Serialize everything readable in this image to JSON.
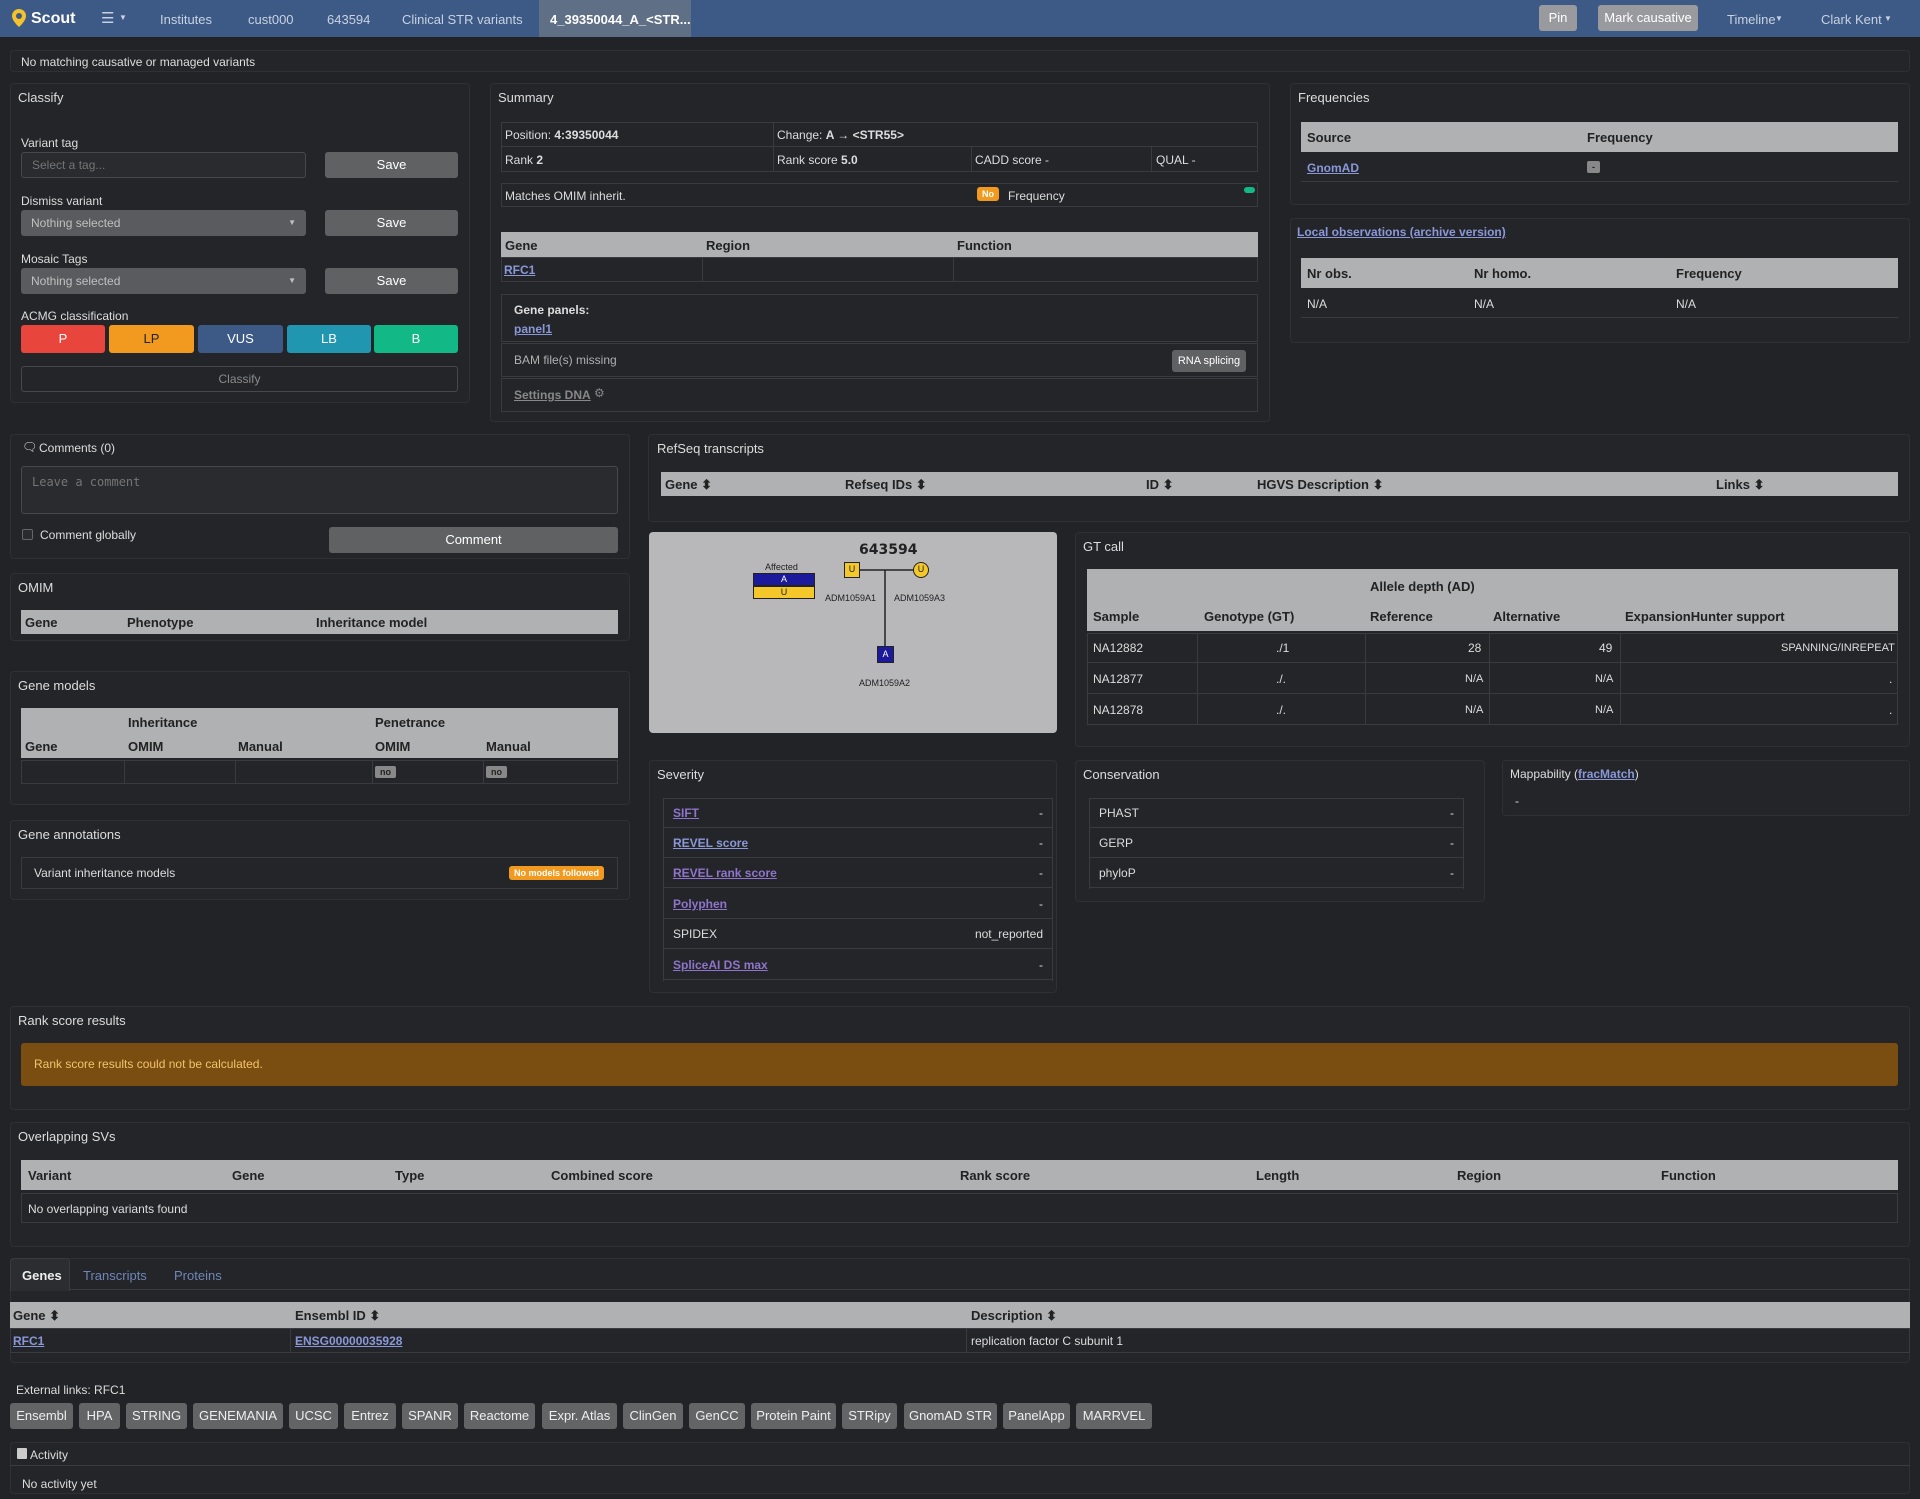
{
  "nav": {
    "brand": "Scout",
    "menu_icon": "☰",
    "items": [
      "Institutes",
      "cust000",
      "643594",
      "Clinical STR variants",
      "4_39350044_A_<STR..."
    ],
    "pin": "Pin",
    "mark_causative": "Mark causative",
    "timeline": "Timeline",
    "user": "Clark Kent"
  },
  "banner": "No matching causative or managed variants",
  "classify": {
    "title": "Classify",
    "tag_label": "Variant tag",
    "tag_placeholder": "Select a tag...",
    "save": "Save",
    "dismiss_label": "Dismiss variant",
    "dismiss_value": "Nothing selected",
    "mosaic_label": "Mosaic Tags",
    "mosaic_value": "Nothing selected",
    "acmg_label": "ACMG classification",
    "acmg": [
      {
        "label": "P",
        "color": "#e8453c"
      },
      {
        "label": "LP",
        "color": "#f29a1f"
      },
      {
        "label": "VUS",
        "color": "#3d5a86"
      },
      {
        "label": "LB",
        "color": "#2196b0"
      },
      {
        "label": "B",
        "color": "#12b886"
      }
    ],
    "classify_btn": "Classify"
  },
  "summary": {
    "title": "Summary",
    "position_label": "Position: ",
    "position_value": "4:39350044",
    "change_label": "Change: ",
    "change_value": "A → <STR55>",
    "rank_label": "Rank ",
    "rank_value": "2",
    "rankscore_label": "Rank score ",
    "rankscore_value": "5.0",
    "cadd": "CADD score -",
    "qual": "QUAL -",
    "omim_label": "Matches OMIM inherit.",
    "omim_badge": "No",
    "frequency": "Frequency",
    "gene_cols": [
      "Gene",
      "Region",
      "Function"
    ],
    "gene": "RFC1",
    "panels_label": "Gene panels:",
    "panel": "panel1",
    "bam": "BAM file(s) missing",
    "rna": "RNA splicing",
    "settings": "Settings DNA"
  },
  "frequencies": {
    "title": "Frequencies",
    "cols": [
      "Source",
      "Frequency"
    ],
    "source": "GnomAD",
    "value": "-"
  },
  "local": {
    "title": "Local observations (archive version)",
    "cols": [
      "Nr obs.",
      "Nr homo.",
      "Frequency"
    ],
    "values": [
      "N/A",
      "N/A",
      "N/A"
    ]
  },
  "comments": {
    "title": "Comments (0)",
    "placeholder": "Leave a comment",
    "global": "Comment globally",
    "button": "Comment"
  },
  "omim": {
    "title": "OMIM",
    "cols": [
      "Gene",
      "Phenotype",
      "Inheritance model"
    ]
  },
  "gene_models": {
    "title": "Gene models",
    "group_inh": "Inheritance",
    "group_pen": "Penetrance",
    "cols": [
      "Gene",
      "OMIM",
      "Manual",
      "OMIM",
      "Manual"
    ],
    "pen_omim": "no",
    "pen_manual": "no"
  },
  "gene_annotations": {
    "title": "Gene annotations",
    "label": "Variant inheritance models",
    "badge": "No models followed"
  },
  "refseq": {
    "title": "RefSeq transcripts",
    "cols": [
      "Gene ⬍",
      "Refseq IDs ⬍",
      "ID ⬍",
      "HGVS Description ⬍",
      "Links ⬍"
    ]
  },
  "pedigree": {
    "case": "643594",
    "affected": "Affected",
    "a": "A",
    "u": "U",
    "father": "ADM1059A1",
    "mother": "ADM1059A3",
    "child": "ADM1059A2"
  },
  "gtcall": {
    "title": "GT call",
    "ad_group": "Allele depth (AD)",
    "cols": [
      "Sample",
      "Genotype (GT)",
      "Reference",
      "Alternative",
      "ExpansionHunter support"
    ],
    "rows": [
      [
        "NA12882",
        "./1",
        "28",
        "49",
        "SPANNING/INREPEAT"
      ],
      [
        "NA12877",
        "./.",
        "N/A",
        "N/A",
        "."
      ],
      [
        "NA12878",
        "./.",
        "N/A",
        "N/A",
        "."
      ]
    ]
  },
  "severity": {
    "title": "Severity",
    "rows": [
      {
        "label": "SIFT",
        "value": "-"
      },
      {
        "label": "REVEL score",
        "value": "-"
      },
      {
        "label": "REVEL rank score",
        "value": "-"
      },
      {
        "label": "Polyphen",
        "value": "-"
      },
      {
        "label": "SPIDEX",
        "value": "not_reported"
      },
      {
        "label": "SpliceAI DS max",
        "value": "-"
      }
    ]
  },
  "conservation": {
    "title": "Conservation",
    "rows": [
      {
        "label": "PHAST",
        "value": "-"
      },
      {
        "label": "GERP",
        "value": "-"
      },
      {
        "label": "phyloP",
        "value": "-"
      }
    ]
  },
  "mappability": {
    "title": "Mappability (",
    "link": "fracMatch",
    "close": ")",
    "value": "-"
  },
  "rankscore": {
    "title": "Rank score results",
    "alert": "Rank score results could not be calculated."
  },
  "overlapping": {
    "title": "Overlapping SVs",
    "cols": [
      "Variant",
      "Gene",
      "Type",
      "Combined score",
      "Rank score",
      "Length",
      "Region",
      "Function"
    ],
    "empty": "No overlapping variants found"
  },
  "genes_tabs": {
    "tabs": [
      "Genes",
      "Transcripts",
      "Proteins"
    ],
    "cols": [
      "Gene ⬍",
      "Ensembl ID ⬍",
      "Description ⬍"
    ],
    "gene": "RFC1",
    "ensembl": "ENSG00000035928",
    "description": "replication factor C subunit 1"
  },
  "external": {
    "label": "External links: RFC1",
    "links": [
      "Ensembl",
      "HPA",
      "STRING",
      "GENEMANIA",
      "UCSC",
      "Entrez",
      "SPANR",
      "Reactome",
      "Expr. Atlas",
      "ClinGen",
      "GenCC",
      "Protein Paint",
      "STRipy",
      "GnomAD STR",
      "PanelApp",
      "MARRVEL"
    ]
  },
  "activity": {
    "title": "Activity",
    "empty": "No activity yet"
  }
}
